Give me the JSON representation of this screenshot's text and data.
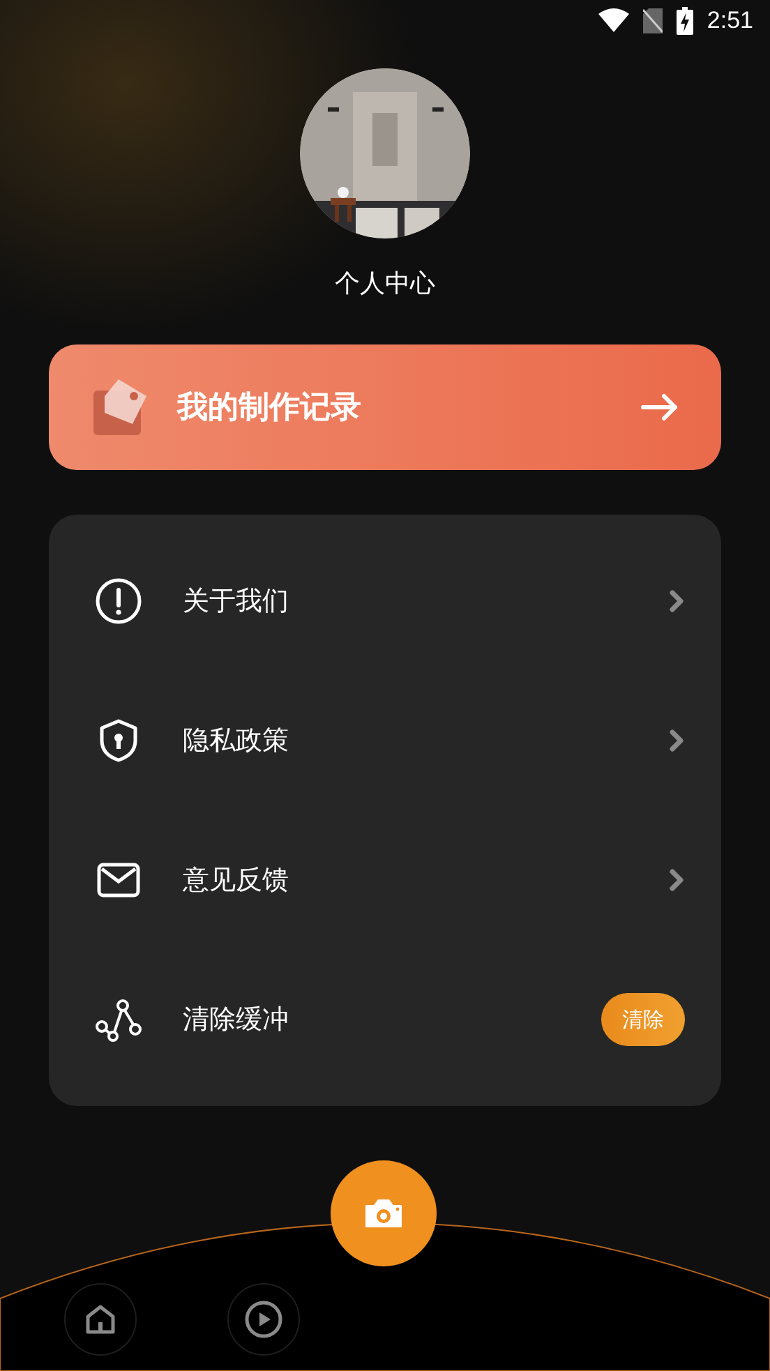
{
  "status_bar": {
    "time": "2:51"
  },
  "profile": {
    "title": "个人中心"
  },
  "records_card": {
    "label": "我的制作记录"
  },
  "menu": [
    {
      "kind": "link",
      "label": "关于我们"
    },
    {
      "kind": "link",
      "label": "隐私政策"
    },
    {
      "kind": "link",
      "label": "意见反馈"
    },
    {
      "kind": "action",
      "label": "清除缓冲",
      "button": "清除"
    }
  ],
  "bottom_nav": [
    {
      "selected": false
    },
    {
      "selected": false
    }
  ]
}
